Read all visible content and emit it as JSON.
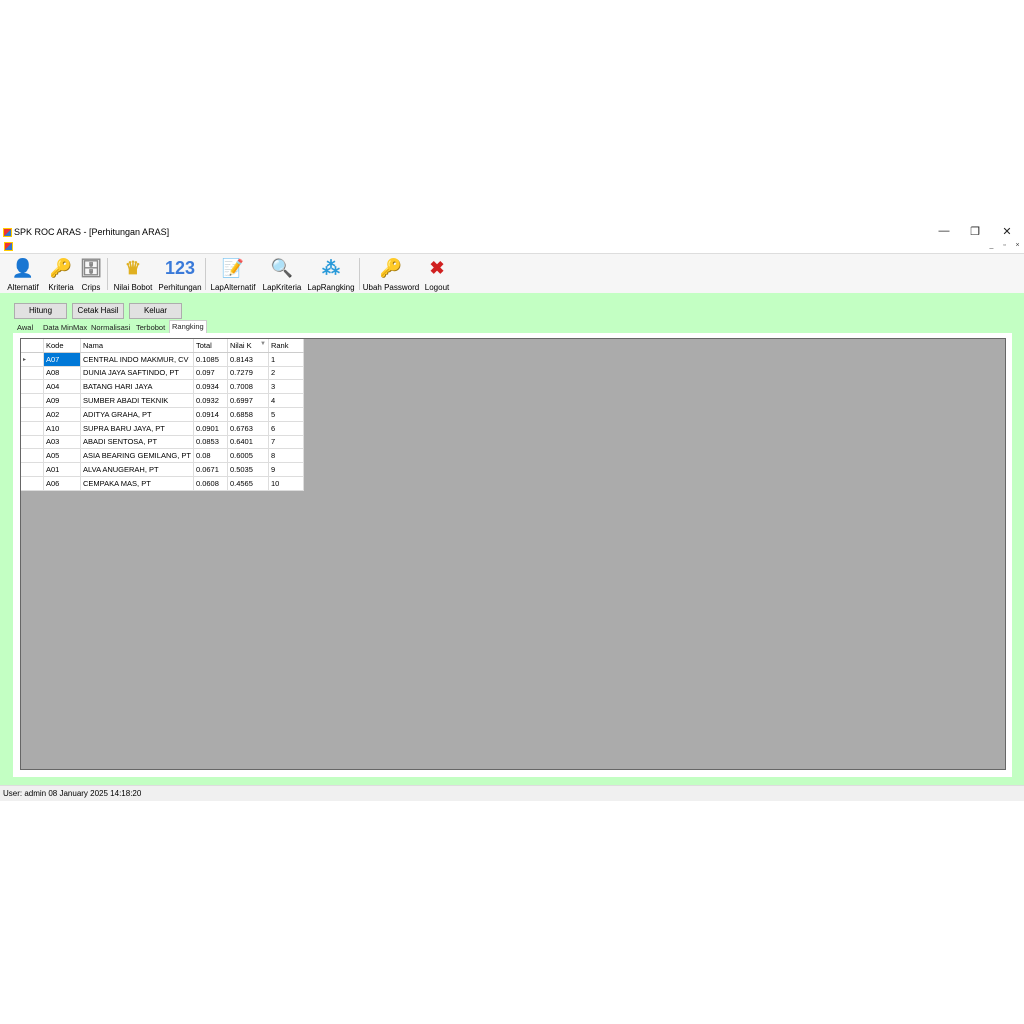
{
  "window": {
    "title": "SPK ROC ARAS - [Perhitungan ARAS]",
    "min": "—",
    "max": "❐",
    "close": "✕",
    "mdi_min": "_",
    "mdi_restore": "▫",
    "mdi_close": "×"
  },
  "toolbar": [
    {
      "label": "Alternatif",
      "icon": "person-icon",
      "glyph": "👤",
      "color": "#8b2a1a"
    },
    {
      "label": "Kriteria",
      "icon": "key-icon",
      "glyph": "🔑",
      "color": "#d4a017"
    },
    {
      "label": "Crips",
      "icon": "database-add-icon",
      "glyph": "🗄",
      "color": "#888"
    },
    {
      "label": "Nilai Bobot",
      "icon": "crown-icon",
      "glyph": "♛",
      "color": "#e0b020"
    },
    {
      "label": "Perhitungan",
      "icon": "numbers-icon",
      "glyph": "123",
      "color": "#3a7ad9"
    },
    {
      "label": "LapAlternatif",
      "icon": "report-icon",
      "glyph": "📝",
      "color": "#3a7ad9"
    },
    {
      "label": "LapKriteria",
      "icon": "report-search-icon",
      "glyph": "🔍",
      "color": "#c33"
    },
    {
      "label": "LapRangking",
      "icon": "chart-network-icon",
      "glyph": "⁂",
      "color": "#2a9ad9"
    },
    {
      "label": "Ubah Password",
      "icon": "key-edit-icon",
      "glyph": "🔑",
      "color": "#d4a017"
    },
    {
      "label": "Logout",
      "icon": "close-x-icon",
      "glyph": "✖",
      "color": "#d02020"
    }
  ],
  "buttons": {
    "hitung": "Hitung",
    "cetak": "Cetak Hasil",
    "keluar": "Keluar"
  },
  "tabs": [
    "Awal",
    "Data MinMax",
    "Normalisasi",
    "Terbobot",
    "Rangking"
  ],
  "grid": {
    "columns": [
      "Kode",
      "Nama",
      "Total",
      "Nilai K",
      "Rank"
    ],
    "sort_glyph": "▼",
    "row_marker": "▸",
    "rows": [
      [
        "A07",
        "CENTRAL INDO MAKMUR, CV",
        "0.1085",
        "0.8143",
        "1"
      ],
      [
        "A08",
        "DUNIA JAYA SAFTINDO, PT",
        "0.097",
        "0.7279",
        "2"
      ],
      [
        "A04",
        "BATANG HARI JAYA",
        "0.0934",
        "0.7008",
        "3"
      ],
      [
        "A09",
        "SUMBER ABADI TEKNIK",
        "0.0932",
        "0.6997",
        "4"
      ],
      [
        "A02",
        "ADITYA GRAHA, PT",
        "0.0914",
        "0.6858",
        "5"
      ],
      [
        "A10",
        "SUPRA BARU JAYA, PT",
        "0.0901",
        "0.6763",
        "6"
      ],
      [
        "A03",
        "ABADI SENTOSA, PT",
        "0.0853",
        "0.6401",
        "7"
      ],
      [
        "A05",
        "ASIA BEARING GEMILANG, PT",
        "0.08",
        "0.6005",
        "8"
      ],
      [
        "A01",
        "ALVA ANUGERAH, PT",
        "0.0671",
        "0.5035",
        "9"
      ],
      [
        "A06",
        "CEMPAKA MAS, PT",
        "0.0608",
        "0.4565",
        "10"
      ]
    ]
  },
  "status": "User: admin  08 January 2025 14:18:20"
}
